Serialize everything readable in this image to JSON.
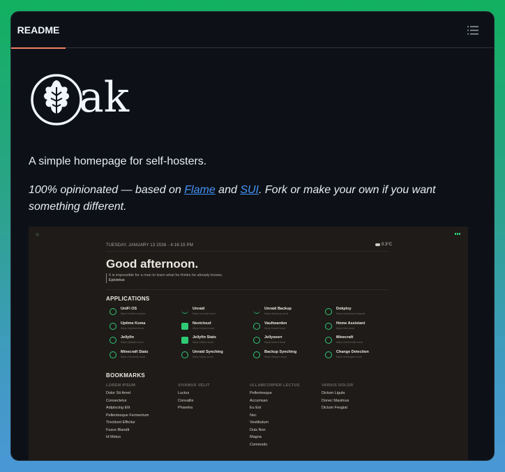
{
  "header": {
    "tab_label": "README"
  },
  "logo": {
    "word": "ak"
  },
  "tagline": "A simple homepage for self-hosters.",
  "para": {
    "prefix": "100% opinionated — based on ",
    "link1": "Flame",
    "middle": " and ",
    "link2": "SUI",
    "suffix": ". Fork or make your own if you want something different."
  },
  "screenshot": {
    "date": "TUESDAY, JANUARY 13 2026 - 4:16:15 PM",
    "weather": "0.3°C",
    "greeting": "Good afternoon.",
    "quote": "It is impossible for a man to learn what he thinks he already knows.",
    "author": "Epictetus",
    "apps_title": "APPLICATIONS",
    "apps": [
      {
        "name": "UniFi OS",
        "url": "https://unifi.example",
        "icon": "unifi-icon"
      },
      {
        "name": "Unraid",
        "url": "https://unraid.local",
        "icon": "unraid-icon"
      },
      {
        "name": "Unraid Backup",
        "url": "https://backup.local",
        "icon": "unraid-backup-icon"
      },
      {
        "name": "Dokploy",
        "url": "https://dokploy.example",
        "icon": "dokploy-icon"
      },
      {
        "name": "Uptime Kuma",
        "url": "https://uptime.local",
        "icon": "uptime-kuma-icon"
      },
      {
        "name": "Nextcloud",
        "url": "https://cloud.local",
        "icon": "nextcloud-icon"
      },
      {
        "name": "Vaultwarden",
        "url": "https://vault.local",
        "icon": "vaultwarden-icon"
      },
      {
        "name": "Home Assistant",
        "url": "https://ha.local",
        "icon": "home-assistant-icon"
      },
      {
        "name": "Jellyfin",
        "url": "https://jellyfin.local",
        "icon": "jellyfin-icon"
      },
      {
        "name": "Jellyfin Stats",
        "url": "https://stats.local",
        "icon": "jellyfin-stats-icon"
      },
      {
        "name": "Jellyseerr",
        "url": "https://seerr.local",
        "icon": "jellyseerr-icon"
      },
      {
        "name": "Minecraft",
        "url": "https://minecraft.local",
        "icon": "minecraft-icon"
      },
      {
        "name": "Minecraft Stats",
        "url": "https://mcstats.local",
        "icon": "minecraft-stats-icon"
      },
      {
        "name": "Unraid Synching",
        "url": "https://sync.local",
        "icon": "unraid-sync-icon"
      },
      {
        "name": "Backup Synching",
        "url": "https://bsync.local",
        "icon": "backup-sync-icon"
      },
      {
        "name": "Change Detection",
        "url": "https://changes.local",
        "icon": "change-detection-icon"
      }
    ],
    "bookmarks_title": "BOOKMARKS",
    "bookmark_cols": [
      {
        "heading": "LOREM IPSUM",
        "links": [
          "Dolor Sit Amet",
          "Consectetur",
          "Adipiscing Elit",
          "Pellentesque Fermentum",
          "Tincidunt Efficitur",
          "Fusce Blandit",
          "Id Metus"
        ]
      },
      {
        "heading": "VIVAMUS VELIT",
        "links": [
          "Luctus",
          "Convallis",
          "Pharetra"
        ]
      },
      {
        "heading": "ULLAMCORPER LECTUS",
        "links": [
          "Pellentesque",
          "Accumsan",
          "Eu Est",
          "Nec",
          "Vestibulum",
          "Duis Non",
          "Magna",
          "Commodo"
        ]
      },
      {
        "heading": "VARIUS DOLOR",
        "links": [
          "Dictum Ligula",
          "Donec Maximus",
          "Dictum Feugiat"
        ]
      }
    ]
  },
  "colors": {
    "accent": "#2fcb74",
    "link": "#4493f8",
    "tab_underline": "#f78166"
  }
}
